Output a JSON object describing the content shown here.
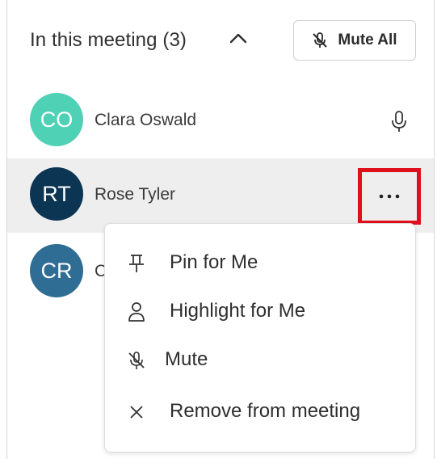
{
  "header": {
    "title": "In this meeting (3)",
    "mute_all_label": "Mute All"
  },
  "participants": [
    {
      "initials": "CO",
      "name": "Clara Oswald",
      "avatar_color": "#4fd1b5"
    },
    {
      "initials": "RT",
      "name": "Rose Tyler",
      "avatar_color": "#0c3554"
    },
    {
      "initials": "CR",
      "name": "C",
      "avatar_color": "#2f6d94"
    }
  ],
  "menu": {
    "items": [
      {
        "label": "Pin for Me",
        "icon": "pin-icon"
      },
      {
        "label": "Highlight for Me",
        "icon": "person-icon"
      },
      {
        "label": "Mute",
        "icon": "mic-off-icon"
      },
      {
        "label": "Remove from meeting",
        "icon": "close-icon"
      }
    ]
  },
  "colors": {
    "highlight_border": "#e0101a",
    "row_hover_bg": "#eeeeee"
  }
}
